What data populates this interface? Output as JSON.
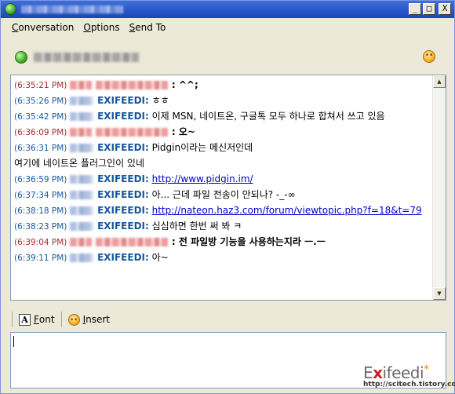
{
  "window": {
    "title_buttons": {
      "minimize": "_",
      "maximize": "□",
      "close": "X"
    }
  },
  "menu": [
    {
      "access": "C",
      "rest": "onversation"
    },
    {
      "access": "O",
      "rest": "ptions"
    },
    {
      "access": "S",
      "rest": "end To"
    }
  ],
  "messages": [
    {
      "time": "(6:35:21 PM)",
      "side": "remote",
      "user": "",
      "text": ": ^^;"
    },
    {
      "time": "(6:35:26 PM)",
      "side": "self",
      "user": "EXIFEEDI:",
      "text": " ㅎㅎ"
    },
    {
      "time": "(6:35:42 PM)",
      "side": "self",
      "user": "EXIFEEDI:",
      "text": " 이제 MSN, 네이트온, 구글톡 모두 하나로 합쳐서 쓰고 있음"
    },
    {
      "time": "(6:36:09 PM)",
      "side": "remote",
      "user": "",
      "text": ": 오~"
    },
    {
      "time": "(6:36:31 PM)",
      "side": "self",
      "user": "EXIFEEDI:",
      "text": " Pidgin이라는 메신저인데"
    },
    {
      "time": "",
      "side": "cont",
      "user": "",
      "text": "여기에 네이트온 플러그인이 있네"
    },
    {
      "time": "(6:36:59 PM)",
      "side": "self",
      "user": "EXIFEEDI:",
      "text": "",
      "link": "http://www.pidgin.im/"
    },
    {
      "time": "(6:37:34 PM)",
      "side": "self",
      "user": "EXIFEEDI:",
      "text": " 아... 근데 파일 전송이 안되나? -_-∞"
    },
    {
      "time": "(6:38:18 PM)",
      "side": "self",
      "user": "EXIFEEDI:",
      "text": "",
      "link": "http://nateon.haz3.com/forum/viewtopic.php?f=18&t=79"
    },
    {
      "time": "(6:38:23 PM)",
      "side": "self",
      "user": "EXIFEEDI:",
      "text": " 심심하면 한번 써 봐 ㅋ"
    },
    {
      "time": "(6:39:04 PM)",
      "side": "remote",
      "user": "",
      "text": ": 전 파일방 기능을 사용하는지라 ㅡ.ㅡ"
    },
    {
      "time": "(6:39:11 PM)",
      "side": "self",
      "user": "EXIFEEDI:",
      "text": " 아~"
    }
  ],
  "toolbar": {
    "font": {
      "access": "F",
      "rest": "ont"
    },
    "insert": {
      "access": "I",
      "rest": "nsert"
    }
  },
  "watermark": {
    "logo_a": "E",
    "logo_x": "x",
    "logo_b": "ifeedi",
    "star": "*",
    "url": "http://scitech.tistory.com/"
  },
  "colors": {
    "remote": "#a82a2a",
    "self": "#16569e",
    "link": "#0000cc"
  }
}
